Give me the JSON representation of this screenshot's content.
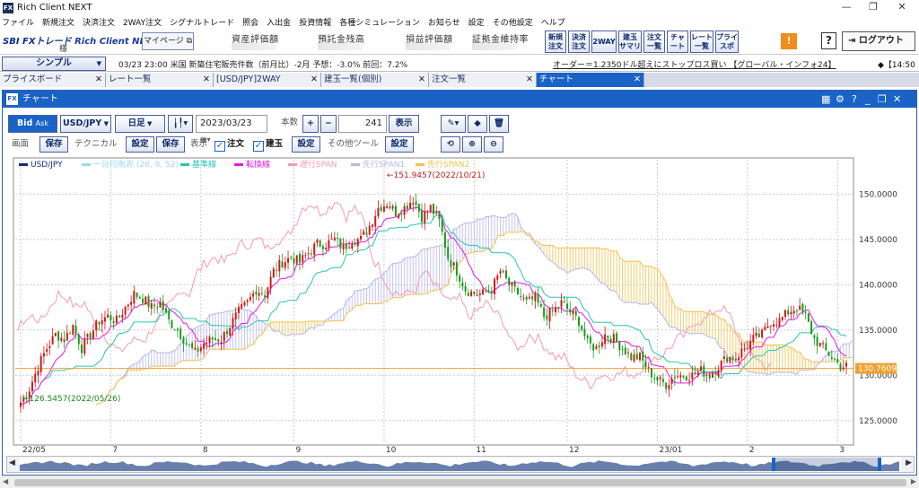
{
  "app": {
    "title": "Rich Client NEXT",
    "icon_label": "FX"
  },
  "window_controls": {
    "minimize": "—",
    "maximize": "❐",
    "close": "✕"
  },
  "menu": [
    "ファイル",
    "新規注文",
    "決済注文",
    "2WAY注文",
    "シグナルトレード",
    "照会",
    "入出金",
    "投資情報",
    "各種シミュレーション",
    "お知らせ",
    "設定",
    "その他設定",
    "ヘルプ"
  ],
  "toolbar": {
    "logo": "SBI FXトレード",
    "logo_sub": "Rich Client NEXT",
    "user_suffix": "様",
    "mypage": "マイページ ⧉",
    "account_labels": [
      "資産評価額",
      "預託金残高",
      "損益評価額",
      "証拠金維持率"
    ],
    "buttons": [
      {
        "l1": "新規",
        "l2": "注文"
      },
      {
        "l1": "決済",
        "l2": "注文"
      },
      {
        "l1": "2WAY",
        "l2": ""
      },
      {
        "l1": "建玉",
        "l2": "サマリ"
      },
      {
        "l1": "注文",
        "l2": "一覧"
      },
      {
        "l1": "チャ",
        "l2": "ート"
      },
      {
        "l1": "レート",
        "l2": "一覧"
      },
      {
        "l1": "プライ",
        "l2": "スボ"
      }
    ],
    "warning": "!",
    "help": "?",
    "logout": "⇥ ログアウト"
  },
  "newsbar": {
    "layout_select": "シンプル",
    "news": "03/23 23:00 米国 新築住宅販売件数（前月比）-2月 予想：-3.0% 前回：7.2%",
    "ticker": "オーダー＝1.2350ドル超えにストップロス買い 【グローバル・インフォ24】",
    "ticker2": "◆【14:50"
  },
  "tabs": [
    {
      "label": "プライスボード",
      "active": false
    },
    {
      "label": "レート一覧",
      "active": false
    },
    {
      "label": "[USD/JPY]2WAY",
      "active": false
    },
    {
      "label": "建玉一覧(個別)",
      "active": false
    },
    {
      "label": "注文一覧",
      "active": false
    },
    {
      "label": "チャート",
      "active": true
    }
  ],
  "chart_window": {
    "title": "チャート",
    "controls": [
      "▦",
      "⚙",
      "?",
      "_",
      "❐",
      "✕"
    ],
    "bid": "Bid",
    "ask": "Ask",
    "pair": "USD/JPY",
    "timeframe": "日足",
    "chart_type_icon": "candlestick-icon",
    "date": "2023/03/23",
    "count_label": "本数",
    "plus": "+",
    "minus": "−",
    "count": "241",
    "display": "表示",
    "row2": {
      "screen": "画面",
      "save": "保存",
      "technical": "テクニカル",
      "settings": "設定",
      "display": "表示",
      "order": "注文",
      "position": "建玉",
      "other_tools": "その他ツール"
    }
  },
  "chart_data": {
    "type": "candlestick",
    "pair": "USD/JPY",
    "legend": [
      {
        "name": "USD/JPY",
        "color": "#1b2a7a"
      },
      {
        "name": "一目均衡表 (26, 9, 52)",
        "color": "#9fd9f3"
      },
      {
        "name": "基準線",
        "color": "#27c6b0"
      },
      {
        "name": "転換線",
        "color": "#e619e6"
      },
      {
        "name": "遅行SPAN",
        "color": "#f59ab0"
      },
      {
        "name": "先行SPAN1",
        "color": "#b5b5f0"
      },
      {
        "name": "先行SPAN2",
        "color": "#f4c04c"
      }
    ],
    "y_ticks": [
      125,
      130,
      135,
      140,
      145,
      150
    ],
    "y_tick_labels": [
      "125.0000",
      "130.0000",
      "135.0000",
      "140.0000",
      "145.0000",
      "150.0000"
    ],
    "ylim": [
      122.5,
      153.8
    ],
    "x_labels": [
      "22/05",
      "7",
      "8",
      "9",
      "10",
      "11",
      "12",
      "23/01",
      "2",
      "3"
    ],
    "high_annotation": "←151.9457(2022/10/21)",
    "low_annotation": "←126.5457(2022/05/26)",
    "current_price": "130.7609",
    "close_path": [
      [
        0,
        127.0
      ],
      [
        3,
        128.5
      ],
      [
        6,
        131
      ],
      [
        9,
        133
      ],
      [
        12,
        134.5
      ],
      [
        15,
        134
      ],
      [
        18,
        135.5
      ],
      [
        21,
        133
      ],
      [
        24,
        134.5
      ],
      [
        27,
        136
      ],
      [
        30,
        136.5
      ],
      [
        33,
        136
      ],
      [
        36,
        137.5
      ],
      [
        39,
        139
      ],
      [
        42,
        138.5
      ],
      [
        45,
        137.5
      ],
      [
        48,
        138
      ],
      [
        51,
        136
      ],
      [
        54,
        135
      ],
      [
        57,
        133.5
      ],
      [
        60,
        132.5
      ],
      [
        63,
        133.5
      ],
      [
        66,
        134
      ],
      [
        69,
        134
      ],
      [
        72,
        135.5
      ],
      [
        75,
        137
      ],
      [
        78,
        138
      ],
      [
        81,
        139.5
      ],
      [
        84,
        139
      ],
      [
        87,
        141.5
      ],
      [
        90,
        142.5
      ],
      [
        93,
        143
      ],
      [
        96,
        142.5
      ],
      [
        99,
        143.5
      ],
      [
        102,
        144.5
      ],
      [
        105,
        144.5
      ],
      [
        108,
        145
      ],
      [
        111,
        144
      ],
      [
        114,
        145
      ],
      [
        117,
        145
      ],
      [
        120,
        146.5
      ],
      [
        123,
        148.5
      ],
      [
        126,
        149
      ],
      [
        129,
        148
      ],
      [
        132,
        148.5
      ],
      [
        135,
        149.5
      ],
      [
        138,
        147.5
      ],
      [
        141,
        148.5
      ],
      [
        144,
        147
      ],
      [
        147,
        143
      ],
      [
        150,
        141.5
      ],
      [
        153,
        139.5
      ],
      [
        156,
        139
      ],
      [
        159,
        139
      ],
      [
        162,
        139.5
      ],
      [
        165,
        141.5
      ],
      [
        168,
        140
      ],
      [
        171,
        139
      ],
      [
        174,
        138
      ],
      [
        177,
        138.5
      ],
      [
        180,
        136.5
      ],
      [
        183,
        137
      ],
      [
        186,
        138
      ],
      [
        189,
        137
      ],
      [
        192,
        136
      ],
      [
        195,
        133.5
      ],
      [
        198,
        133
      ],
      [
        201,
        134.5
      ],
      [
        204,
        134
      ],
      [
        207,
        133
      ],
      [
        210,
        132
      ],
      [
        213,
        132
      ],
      [
        216,
        130.5
      ],
      [
        219,
        129.5
      ],
      [
        222,
        129
      ],
      [
        225,
        130
      ],
      [
        228,
        130
      ],
      [
        231,
        130
      ],
      [
        234,
        130.5
      ],
      [
        237,
        130
      ],
      [
        240,
        131
      ],
      [
        243,
        132
      ],
      [
        246,
        132
      ],
      [
        249,
        133
      ],
      [
        252,
        134
      ],
      [
        255,
        134.5
      ],
      [
        258,
        136
      ],
      [
        261,
        136
      ],
      [
        264,
        137
      ],
      [
        267,
        137.5
      ],
      [
        270,
        136.5
      ],
      [
        273,
        134
      ],
      [
        276,
        133
      ],
      [
        279,
        132
      ],
      [
        282,
        131
      ]
    ]
  },
  "navigator": {
    "left_arrow": "◀",
    "right_arrow": "▶"
  },
  "hscroll": {
    "left_arrow": "◀",
    "right_arrow": "▶"
  }
}
